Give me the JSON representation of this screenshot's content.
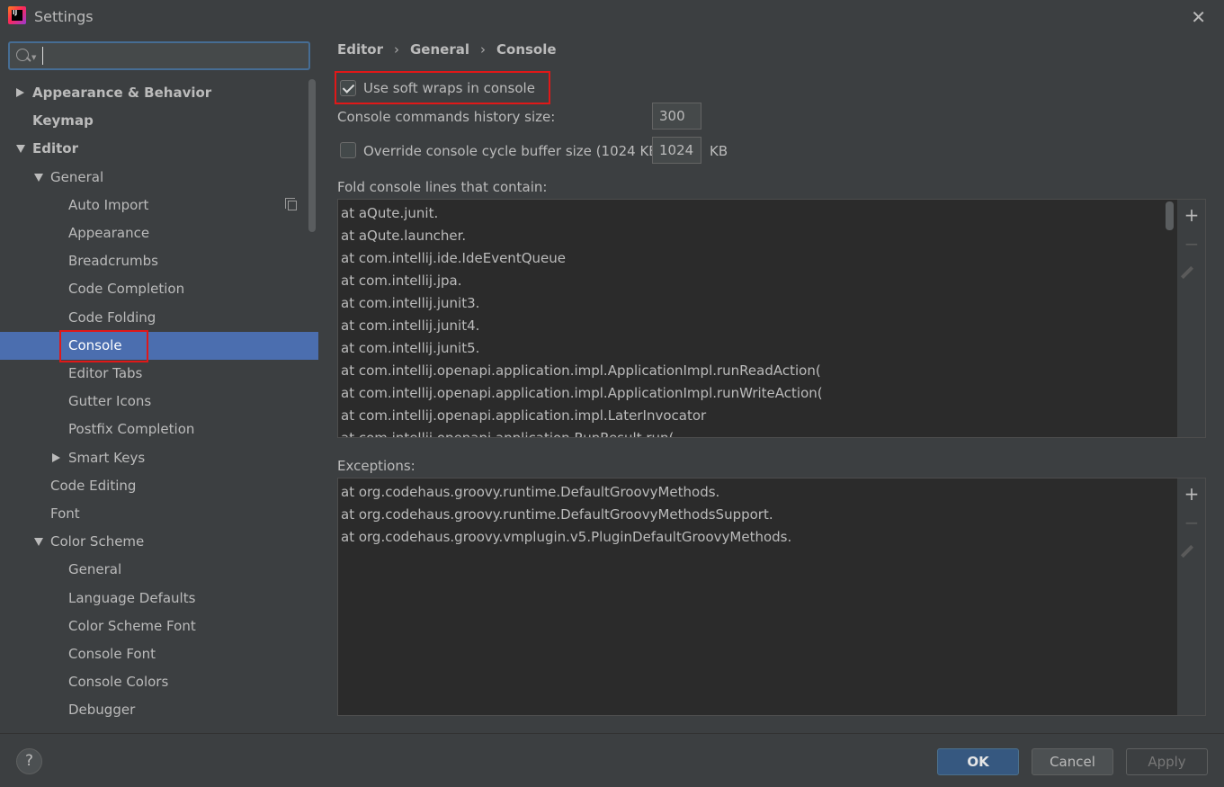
{
  "window": {
    "title": "Settings",
    "close_glyph": "✕",
    "app_icon_text": "IJ"
  },
  "search": {
    "value": "",
    "placeholder": ""
  },
  "tree": [
    {
      "label": "Appearance & Behavior",
      "bold": true,
      "level": 0,
      "expander": "collapsed"
    },
    {
      "label": "Keymap",
      "bold": true,
      "level": 0,
      "expander": "none"
    },
    {
      "label": "Editor",
      "bold": true,
      "level": 0,
      "expander": "expanded"
    },
    {
      "label": "General",
      "bold": false,
      "level": 1,
      "expander": "expanded"
    },
    {
      "label": "Auto Import",
      "bold": false,
      "level": 2,
      "expander": "none",
      "icon": "copy-icon"
    },
    {
      "label": "Appearance",
      "bold": false,
      "level": 2,
      "expander": "none"
    },
    {
      "label": "Breadcrumbs",
      "bold": false,
      "level": 2,
      "expander": "none"
    },
    {
      "label": "Code Completion",
      "bold": false,
      "level": 2,
      "expander": "none"
    },
    {
      "label": "Code Folding",
      "bold": false,
      "level": 2,
      "expander": "none"
    },
    {
      "label": "Console",
      "bold": false,
      "level": 2,
      "expander": "none",
      "selected": true
    },
    {
      "label": "Editor Tabs",
      "bold": false,
      "level": 2,
      "expander": "none"
    },
    {
      "label": "Gutter Icons",
      "bold": false,
      "level": 2,
      "expander": "none"
    },
    {
      "label": "Postfix Completion",
      "bold": false,
      "level": 2,
      "expander": "none"
    },
    {
      "label": "Smart Keys",
      "bold": false,
      "level": 2,
      "expander": "collapsed"
    },
    {
      "label": "Code Editing",
      "bold": false,
      "level": 1,
      "expander": "none"
    },
    {
      "label": "Font",
      "bold": false,
      "level": 1,
      "expander": "none"
    },
    {
      "label": "Color Scheme",
      "bold": false,
      "level": 1,
      "expander": "expanded"
    },
    {
      "label": "General",
      "bold": false,
      "level": 2,
      "expander": "none"
    },
    {
      "label": "Language Defaults",
      "bold": false,
      "level": 2,
      "expander": "none"
    },
    {
      "label": "Color Scheme Font",
      "bold": false,
      "level": 2,
      "expander": "none"
    },
    {
      "label": "Console Font",
      "bold": false,
      "level": 2,
      "expander": "none"
    },
    {
      "label": "Console Colors",
      "bold": false,
      "level": 2,
      "expander": "none"
    },
    {
      "label": "Debugger",
      "bold": false,
      "level": 2,
      "expander": "none"
    }
  ],
  "breadcrumb": [
    "Editor",
    "General",
    "Console"
  ],
  "breadcrumb_sep": "›",
  "settings": {
    "soft_wraps_label": "Use soft wraps in console",
    "soft_wraps_checked": true,
    "history_label": "Console commands history size:",
    "history_value": "300",
    "override_label": "Override console cycle buffer size (1024 KB)",
    "override_checked": false,
    "override_value": "1024",
    "override_unit": "KB",
    "fold_label": "Fold console lines that contain:",
    "exceptions_label": "Exceptions:"
  },
  "fold_lines": [
    "at aQute.junit.",
    "at aQute.launcher.",
    "at com.intellij.ide.IdeEventQueue",
    "at com.intellij.jpa.",
    "at com.intellij.junit3.",
    "at com.intellij.junit4.",
    "at com.intellij.junit5.",
    "at com.intellij.openapi.application.impl.ApplicationImpl.runReadAction(",
    "at com.intellij.openapi.application.impl.ApplicationImpl.runWriteAction(",
    "at com.intellij.openapi.application.impl.LaterInvocator",
    "at com.intellij.openapi.application.RunResult.run("
  ],
  "exception_lines": [
    "at org.codehaus.groovy.runtime.DefaultGroovyMethods.",
    "at org.codehaus.groovy.runtime.DefaultGroovyMethodsSupport.",
    "at org.codehaus.groovy.vmplugin.v5.PluginDefaultGroovyMethods."
  ],
  "toolbar_glyphs": {
    "add": "+",
    "remove": "−"
  },
  "buttons": {
    "help": "?",
    "ok": "OK",
    "cancel": "Cancel",
    "apply": "Apply"
  },
  "colors": {
    "background": "#3c3f41",
    "selection": "#4b6eaf",
    "highlight_box": "#e01818",
    "ok_button": "#365880"
  }
}
